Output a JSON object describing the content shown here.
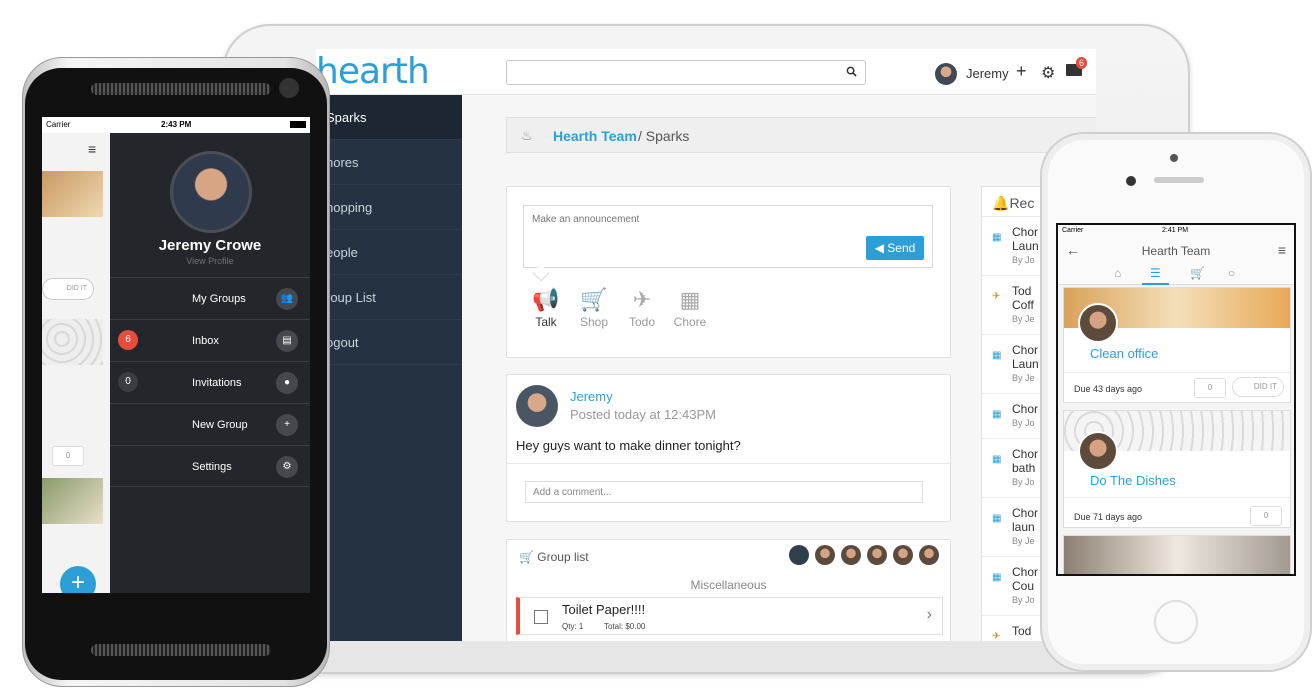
{
  "tablet": {
    "logo": "hearth",
    "search": {
      "value": "",
      "placeholder": ""
    },
    "user_name": "Jeremy",
    "mail_badge": "6",
    "sidebar": [
      "Sparks",
      "hores",
      "hopping",
      "eople",
      "roup List",
      "ogout"
    ],
    "breadcrumb": {
      "team": "Hearth Team",
      "separator": "/ Sparks"
    },
    "announcement": {
      "placeholder": "Make an announcement",
      "send_label": "Send",
      "options": [
        "Talk",
        "Shop",
        "Todo",
        "Chore"
      ]
    },
    "post": {
      "author": "Jeremy",
      "time": "Posted today at 12:43PM",
      "text": "Hey guys want to make dinner tonight?",
      "comment_placeholder": "Add a comment..."
    },
    "group_list": {
      "title": "Group list",
      "section": "Miscellaneous",
      "item": {
        "name": "Toilet Paper!!!!",
        "qty": "Qty: 1",
        "total": "Total: $0.00"
      }
    },
    "recent": {
      "title": "Rec",
      "items": [
        {
          "l1": "Chor",
          "l2": "Laun",
          "by": "By Jo"
        },
        {
          "l1": "Tod",
          "l2": "Coff",
          "by": "By Je"
        },
        {
          "l1": "Chor",
          "l2": "Laun",
          "by": "By Je"
        },
        {
          "l1": "Chor",
          "l2": "",
          "by": "By Jo"
        },
        {
          "l1": "Chor",
          "l2": "bath",
          "by": "By Jo"
        },
        {
          "l1": "Chor",
          "l2": "laun",
          "by": "By Je"
        },
        {
          "l1": "Chor",
          "l2": "Cou",
          "by": "By Jo"
        },
        {
          "l1": "Tod",
          "l2": "",
          "by": ""
        }
      ]
    }
  },
  "android": {
    "status": {
      "carrier": "Carrier",
      "time": "2:43 PM"
    },
    "profile": {
      "name": "Jeremy Crowe",
      "link": "View Profile"
    },
    "menu": [
      {
        "label": "My Groups",
        "badge": "",
        "icon": "group-icon"
      },
      {
        "label": "Inbox",
        "badge": "6",
        "icon": "chat-icon"
      },
      {
        "label": "Invitations",
        "badge": "0",
        "icon": "person-icon"
      },
      {
        "label": "New Group",
        "badge": "",
        "icon": "plus-icon"
      },
      {
        "label": "Settings",
        "badge": "",
        "icon": "gear-icon"
      }
    ],
    "behind": {
      "did_it": "DID IT",
      "comment_count": "0"
    },
    "fab": "+"
  },
  "iphone": {
    "status": {
      "carrier": "Carrier",
      "time": "2:41 PM"
    },
    "title": "Hearth Team",
    "cards": [
      {
        "title": "Clean office",
        "due": "Due 43 days ago",
        "comments": "0",
        "did_it": "DID IT"
      },
      {
        "title": "Do The Dishes",
        "due": "Due 71 days ago",
        "comments": "0"
      }
    ]
  },
  "colors": {
    "accent": "#2ca0d6",
    "sidebar": "#253241",
    "drawer": "#23262a",
    "badge_red": "#e74c3c"
  }
}
